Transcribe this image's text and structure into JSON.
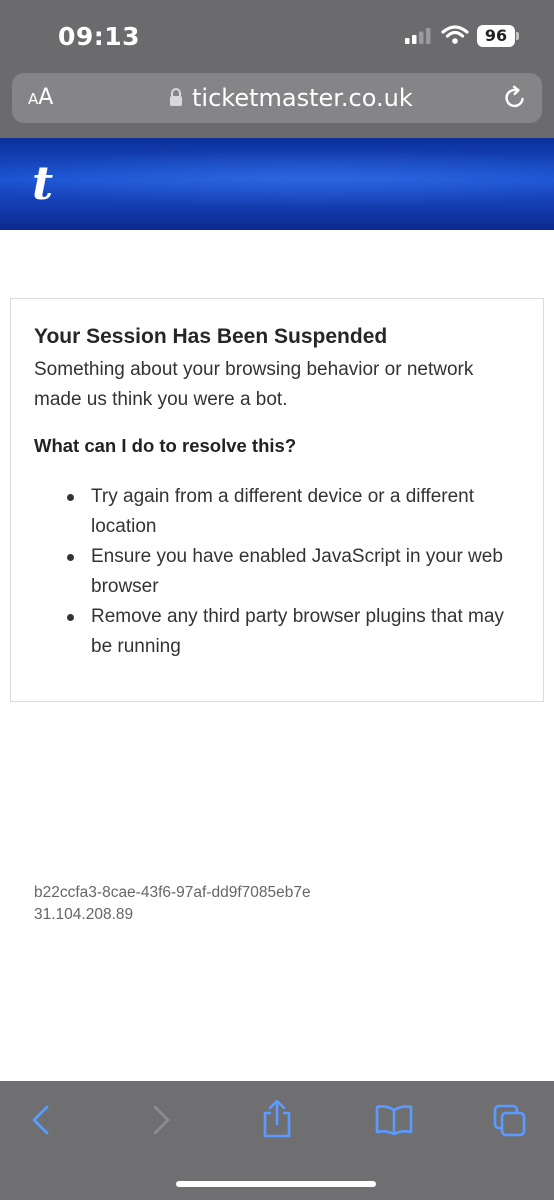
{
  "status_bar": {
    "time": "09:13",
    "battery": "96",
    "icons": [
      "cellular-signal-icon",
      "wifi-icon",
      "battery-icon"
    ]
  },
  "browser": {
    "aa_label_small": "A",
    "aa_label_large": "A",
    "url": "ticketmaster.co.uk",
    "icons": [
      "lock-icon",
      "reload-icon"
    ]
  },
  "site_header": {
    "logo": "t",
    "colors": {
      "primary": "#1a52d0",
      "dark": "#0b2a8f"
    }
  },
  "error_card": {
    "title": "Your Session Has Been Suspended",
    "description": "Something about your browsing behavior or network made us think you were a bot.",
    "subheading": "What can I do to resolve this?",
    "tips": [
      "Try again from a different device or a different location",
      "Ensure you have enabled JavaScript in your web browser",
      "Remove any third party browser plugins that may be running"
    ]
  },
  "reference": {
    "session_id": "b22ccfa3-8cae-43f6-97af-dd9f7085eb7e",
    "ip_address": "31.104.208.89"
  },
  "toolbar": {
    "icons": [
      "back-icon",
      "forward-icon",
      "share-icon",
      "bookmarks-icon",
      "tabs-icon"
    ],
    "accent_color": "#5b9bff"
  }
}
